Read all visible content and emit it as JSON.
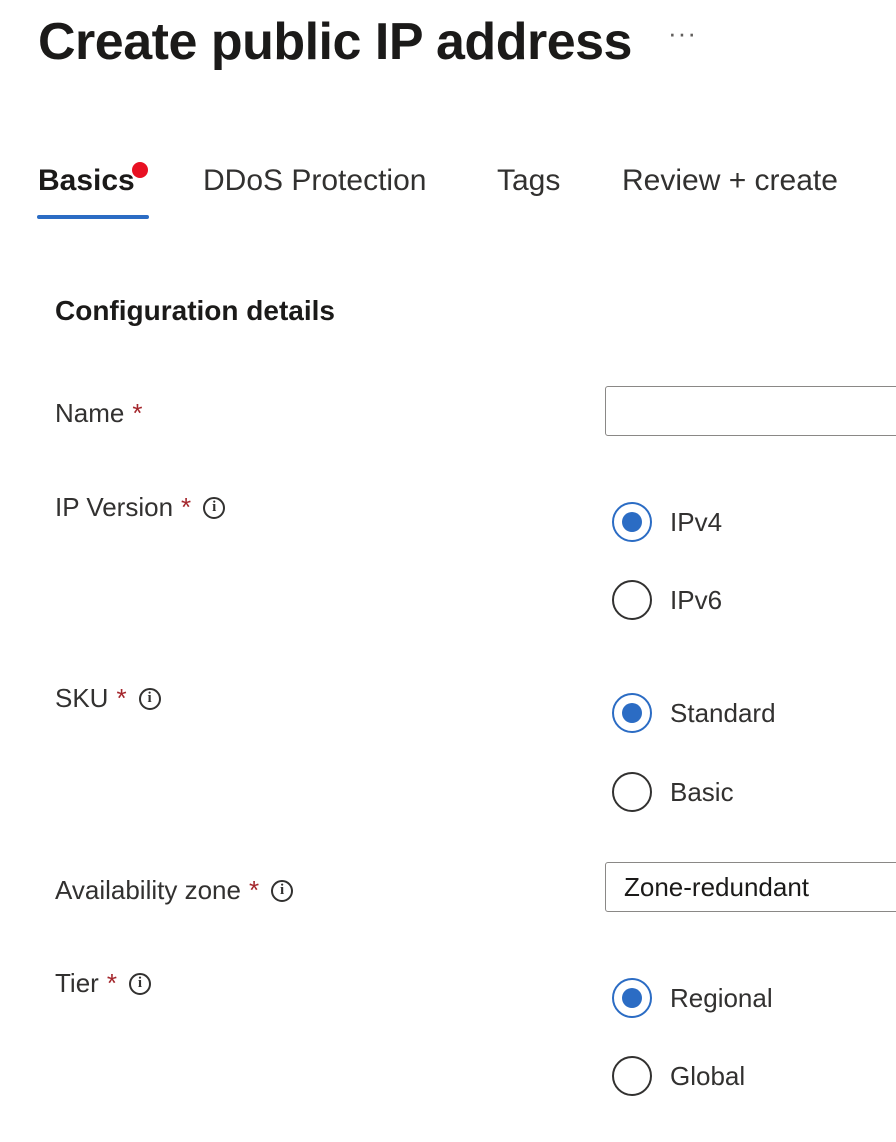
{
  "header": {
    "title": "Create public IP address",
    "more": "···"
  },
  "tabs": [
    {
      "label": "Basics",
      "active": true,
      "has_error": true
    },
    {
      "label": "DDoS Protection"
    },
    {
      "label": "Tags"
    },
    {
      "label": "Review + create"
    }
  ],
  "section_title": "Configuration details",
  "fields": {
    "name": {
      "label": "Name",
      "required": "*",
      "value": ""
    },
    "ip_version": {
      "label": "IP Version",
      "required": "*",
      "info": "i",
      "options": [
        "IPv4",
        "IPv6"
      ],
      "selected": "IPv4"
    },
    "sku": {
      "label": "SKU",
      "required": "*",
      "info": "i",
      "options": [
        "Standard",
        "Basic"
      ],
      "selected": "Standard"
    },
    "availability_zone": {
      "label": "Availability zone",
      "required": "*",
      "info": "i",
      "value": "Zone-redundant"
    },
    "tier": {
      "label": "Tier",
      "required": "*",
      "info": "i",
      "options": [
        "Regional",
        "Global"
      ],
      "selected": "Regional"
    }
  },
  "colors": {
    "accent": "#2b6cc4",
    "error_dot": "#e81123",
    "required": "#a4262c"
  }
}
